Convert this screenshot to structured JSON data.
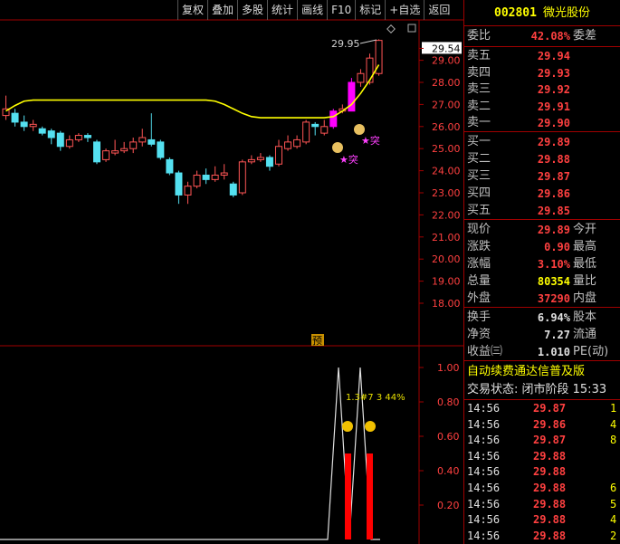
{
  "toolbar": {
    "buttons": [
      "复权",
      "叠加",
      "多股",
      "统计",
      "画线",
      "F10",
      "标记",
      "+自选",
      "返回"
    ]
  },
  "stock": {
    "code": "002801",
    "name": "微光股份"
  },
  "price_axis": {
    "labels": [
      "29.54",
      "29.00",
      "28.00",
      "27.00",
      "26.00",
      "25.00",
      "24.00",
      "23.00",
      "22.00",
      "21.00",
      "20.00",
      "19.00",
      "18.00"
    ]
  },
  "indicator_axis": {
    "labels": [
      "1.00",
      "0.80",
      "0.60",
      "0.40",
      "0.20"
    ]
  },
  "annotations": {
    "high_label": "29.95",
    "tag_yu": "预",
    "star_label_1": "★突",
    "star_label_2": "★突",
    "indicator_text": "1.3#7 3 44%"
  },
  "orderbook": {
    "weibi_label": "委比",
    "weibi_value": "42.08%",
    "weicha_label": "委差",
    "asks": [
      {
        "label": "卖五",
        "price": "29.94"
      },
      {
        "label": "卖四",
        "price": "29.93"
      },
      {
        "label": "卖三",
        "price": "29.92"
      },
      {
        "label": "卖二",
        "price": "29.91"
      },
      {
        "label": "卖一",
        "price": "29.90"
      }
    ],
    "bids": [
      {
        "label": "买一",
        "price": "29.89"
      },
      {
        "label": "买二",
        "price": "29.88"
      },
      {
        "label": "买三",
        "price": "29.87"
      },
      {
        "label": "买四",
        "price": "29.86"
      },
      {
        "label": "买五",
        "price": "29.85"
      }
    ]
  },
  "quote": [
    {
      "label": "现价",
      "value": "29.89",
      "label2": "今开",
      "color": "red"
    },
    {
      "label": "涨跌",
      "value": "0.90",
      "label2": "最高",
      "color": "red"
    },
    {
      "label": "涨幅",
      "value": "3.10%",
      "label2": "最低",
      "color": "red"
    },
    {
      "label": "总量",
      "value": "80354",
      "label2": "量比",
      "color": "yel"
    },
    {
      "label": "外盘",
      "value": "37290",
      "label2": "内盘",
      "color": "red"
    }
  ],
  "fundamentals": [
    {
      "label": "换手",
      "value": "6.94%",
      "label2": "股本"
    },
    {
      "label": "净资",
      "value": "7.27",
      "label2": "流通"
    },
    {
      "label": "收益㈢",
      "value": "1.010",
      "label2": "PE(动)"
    }
  ],
  "ticker_text": "自动续费通达信普及版",
  "trade_status": "交易状态: 闭市阶段 15:33",
  "ticks": [
    {
      "time": "14:56",
      "price": "29.87",
      "vol": "1"
    },
    {
      "time": "14:56",
      "price": "29.86",
      "vol": "4"
    },
    {
      "time": "14:56",
      "price": "29.87",
      "vol": "8"
    },
    {
      "time": "14:56",
      "price": "29.88",
      "vol": ""
    },
    {
      "time": "14:56",
      "price": "29.88",
      "vol": ""
    },
    {
      "time": "14:56",
      "price": "29.88",
      "vol": "6"
    },
    {
      "time": "14:56",
      "price": "29.88",
      "vol": "5"
    },
    {
      "time": "14:56",
      "price": "29.88",
      "vol": "4"
    },
    {
      "time": "14:56",
      "price": "29.88",
      "vol": "2"
    }
  ],
  "candles": [
    {
      "o": 26.5,
      "c": 26.8,
      "h": 27.4,
      "l": 26.3
    },
    {
      "o": 26.6,
      "c": 26.2,
      "h": 26.8,
      "l": 26.0
    },
    {
      "o": 26.2,
      "c": 26.0,
      "h": 26.5,
      "l": 25.8
    },
    {
      "o": 26.0,
      "c": 26.1,
      "h": 26.3,
      "l": 25.8
    },
    {
      "o": 25.9,
      "c": 25.7,
      "h": 26.0,
      "l": 25.6
    },
    {
      "o": 25.8,
      "c": 25.5,
      "h": 25.9,
      "l": 25.2
    },
    {
      "o": 25.7,
      "c": 25.1,
      "h": 25.8,
      "l": 24.9
    },
    {
      "o": 25.1,
      "c": 25.4,
      "h": 25.6,
      "l": 25.0
    },
    {
      "o": 25.4,
      "c": 25.6,
      "h": 25.7,
      "l": 25.3
    },
    {
      "o": 25.6,
      "c": 25.5,
      "h": 25.7,
      "l": 25.3
    },
    {
      "o": 25.3,
      "c": 24.4,
      "h": 25.4,
      "l": 24.3
    },
    {
      "o": 24.5,
      "c": 24.9,
      "h": 25.0,
      "l": 24.4
    },
    {
      "o": 24.8,
      "c": 24.9,
      "h": 25.4,
      "l": 24.7
    },
    {
      "o": 24.9,
      "c": 25.0,
      "h": 25.3,
      "l": 24.8
    },
    {
      "o": 25.0,
      "c": 25.3,
      "h": 25.5,
      "l": 24.8
    },
    {
      "o": 25.3,
      "c": 25.5,
      "h": 25.9,
      "l": 25.1
    },
    {
      "o": 25.4,
      "c": 25.2,
      "h": 26.6,
      "l": 25.1
    },
    {
      "o": 25.3,
      "c": 24.6,
      "h": 25.4,
      "l": 24.5
    },
    {
      "o": 24.5,
      "c": 23.9,
      "h": 24.6,
      "l": 23.8
    },
    {
      "o": 23.9,
      "c": 22.9,
      "h": 24.0,
      "l": 22.5
    },
    {
      "o": 22.9,
      "c": 23.3,
      "h": 23.5,
      "l": 22.5
    },
    {
      "o": 23.3,
      "c": 23.8,
      "h": 24.0,
      "l": 23.2
    },
    {
      "o": 23.8,
      "c": 23.6,
      "h": 24.1,
      "l": 23.4
    },
    {
      "o": 23.6,
      "c": 23.8,
      "h": 24.2,
      "l": 23.5
    },
    {
      "o": 23.8,
      "c": 23.9,
      "h": 24.3,
      "l": 23.6
    },
    {
      "o": 23.4,
      "c": 22.9,
      "h": 23.5,
      "l": 22.8
    },
    {
      "o": 23.0,
      "c": 24.4,
      "h": 24.5,
      "l": 22.9
    },
    {
      "o": 24.4,
      "c": 24.5,
      "h": 24.7,
      "l": 24.3
    },
    {
      "o": 24.5,
      "c": 24.6,
      "h": 24.8,
      "l": 24.4
    },
    {
      "o": 24.6,
      "c": 24.2,
      "h": 24.7,
      "l": 24.0
    },
    {
      "o": 24.3,
      "c": 25.1,
      "h": 25.4,
      "l": 24.2
    },
    {
      "o": 25.0,
      "c": 25.3,
      "h": 25.6,
      "l": 24.9
    },
    {
      "o": 25.1,
      "c": 25.4,
      "h": 25.6,
      "l": 25.0
    },
    {
      "o": 25.3,
      "c": 26.2,
      "h": 26.3,
      "l": 25.2
    },
    {
      "o": 26.1,
      "c": 26.0,
      "h": 26.2,
      "l": 25.6
    },
    {
      "o": 25.7,
      "c": 26.0,
      "h": 26.3,
      "l": 25.6
    },
    {
      "o": 26.0,
      "c": 26.7,
      "h": 26.8,
      "l": 25.9,
      "pink": true
    },
    {
      "o": 26.7,
      "c": 26.8,
      "h": 27.0,
      "l": 26.6
    },
    {
      "o": 26.7,
      "c": 28.0,
      "h": 28.2,
      "l": 26.7,
      "pink": true
    },
    {
      "o": 28.0,
      "c": 28.4,
      "h": 28.6,
      "l": 27.8
    },
    {
      "o": 28.0,
      "c": 29.1,
      "h": 29.3,
      "l": 27.9
    },
    {
      "o": 28.4,
      "c": 29.9,
      "h": 29.95,
      "l": 28.3
    }
  ],
  "ma_line": [
    26.7,
    26.95,
    27.15,
    27.2,
    27.2,
    27.2,
    27.2,
    27.2,
    27.2,
    27.2,
    27.2,
    27.2,
    27.2,
    27.2,
    27.2,
    27.2,
    27.2,
    27.2,
    27.2,
    27.2,
    27.2,
    27.2,
    27.2,
    27.15,
    27.0,
    26.8,
    26.6,
    26.45,
    26.4,
    26.4,
    26.4,
    26.4,
    26.4,
    26.4,
    26.4,
    26.4,
    26.45,
    26.7,
    27.0,
    27.5,
    28.1,
    28.8
  ],
  "colors": {
    "up": "#ff5555",
    "down": "#54e0f0",
    "pink": "#ff00ff",
    "ma": "#ffff00",
    "grid": "#a00000"
  }
}
